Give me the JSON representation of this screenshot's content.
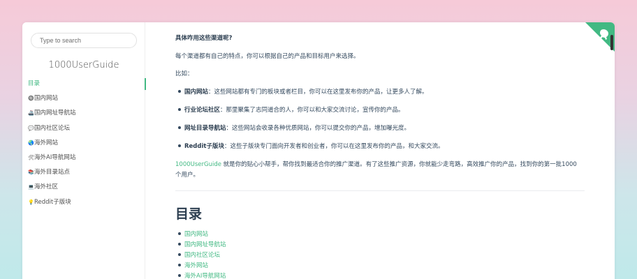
{
  "sidebar": {
    "search_placeholder": "Type to search",
    "app_name": "1000UserGuide",
    "items": [
      {
        "icon": "",
        "label": "目录"
      },
      {
        "icon": "🔘",
        "label": "国内网站"
      },
      {
        "icon": "🚢",
        "label": "国内网址导航站"
      },
      {
        "icon": "💬",
        "label": "国内社区论坛"
      },
      {
        "icon": "🌏",
        "label": "海外网站"
      },
      {
        "icon": "🛠",
        "label": "海外AI导航网站"
      },
      {
        "icon": "📚",
        "label": "海外目录站点"
      },
      {
        "icon": "💻",
        "label": "海外社区"
      },
      {
        "icon": "💡",
        "label": "Reddit子版块"
      }
    ]
  },
  "content": {
    "question": "具体咋用这些渠道呢?",
    "intro": "每个渠道都有自己的特点，你可以根据自己的产品和目标用户来选择。",
    "example_label": "比如：",
    "bullets": [
      {
        "lead": "国内网站",
        "text": "：这些网站都有专门的板块或者栏目，你可以在这里发布你的产品，让更多人了解。"
      },
      {
        "lead": "行业论坛社区",
        "text": "：那里聚集了志同道合的人，你可以和大家交流讨论，宣传你的产品。"
      },
      {
        "lead": "网址目录导航站",
        "text": "：这些网站会收录各种优质网站，你可以提交你的产品，增加曝光度。"
      },
      {
        "lead": "Reddit子版块",
        "text": "：这些子版块专门面向开发者和创业者，你可以在这里发布你的产品，和大家交流。"
      }
    ],
    "outro_link": "1000UserGuide",
    "outro_line1": " 就是你的贴心小帮手，帮你找到最适合你的推广渠道。有了这些推广资源，你就能少走弯路，高效推广你的产品，找到你的第一批1000",
    "outro_line2": "个用户。",
    "toc_heading": "目录",
    "toc": [
      "国内网站",
      "国内网址导航站",
      "国内社区论坛",
      "海外网站",
      "海外AI导航网站"
    ]
  },
  "colors": {
    "accent": "#42b983",
    "text": "#34495e",
    "heading": "#2c3e50"
  }
}
